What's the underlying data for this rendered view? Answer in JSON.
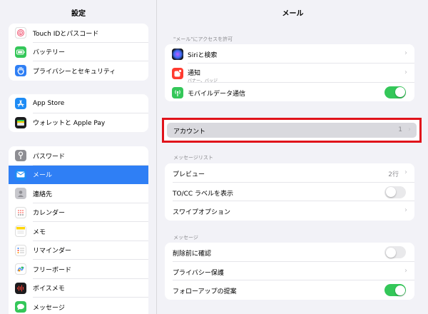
{
  "sidebar": {
    "title": "設定",
    "groups": [
      [
        {
          "label": "Touch IDとパスコード",
          "icon": "fingerprint-icon",
          "color": "#ffffff"
        },
        {
          "label": "バッテリー",
          "icon": "battery-icon",
          "color": "#34c759"
        },
        {
          "label": "プライバシーとセキュリティ",
          "icon": "hand-icon",
          "color": "#2f7ff5"
        }
      ],
      [
        {
          "label": "App Store",
          "icon": "app-store-icon",
          "color": "#1e8cf5"
        },
        {
          "label": "ウォレットと Apple Pay",
          "icon": "wallet-icon",
          "color": "#1c1c1e"
        }
      ],
      [
        {
          "label": "パスワード",
          "icon": "key-icon",
          "color": "#8e8e93"
        },
        {
          "label": "メール",
          "icon": "mail-icon",
          "color": "#1e8cf5",
          "selected": true
        },
        {
          "label": "連絡先",
          "icon": "contacts-icon",
          "color": "#c7c7cc"
        },
        {
          "label": "カレンダー",
          "icon": "calendar-icon",
          "color": "#ffffff"
        },
        {
          "label": "メモ",
          "icon": "notes-icon",
          "color": "#ffd60a"
        },
        {
          "label": "リマインダー",
          "icon": "reminders-icon",
          "color": "#ffffff"
        },
        {
          "label": "フリーボード",
          "icon": "freeform-icon",
          "color": "#ffffff"
        },
        {
          "label": "ボイスメモ",
          "icon": "voice-memo-icon",
          "color": "#1c1c1e"
        },
        {
          "label": "メッセージ",
          "icon": "messages-icon",
          "color": "#34c759"
        }
      ]
    ]
  },
  "main": {
    "title": "メール",
    "section1_header": "\"メール\"にアクセスを許可",
    "siri_label": "Siriと検索",
    "notif_label": "通知",
    "notif_sub": "バナー、バッジ",
    "mobile_label": "モバイルデータ通信",
    "account_label": "アカウント",
    "account_value": "1",
    "section2_header": "メッセージリスト",
    "preview_label": "プレビュー",
    "preview_value": "2行",
    "tocc_label": "TO/CC ラベルを表示",
    "swipe_label": "スワイプオプション",
    "section3_header": "メッセージ",
    "confirm_delete_label": "削除前に確認",
    "privacy_label": "プライバシー保護",
    "followup_label": "フォローアップの提案",
    "chevron": "›"
  },
  "colors": {
    "accent": "#2f7ff5",
    "toggle_on": "#34c759",
    "highlight": "#e0131b"
  }
}
